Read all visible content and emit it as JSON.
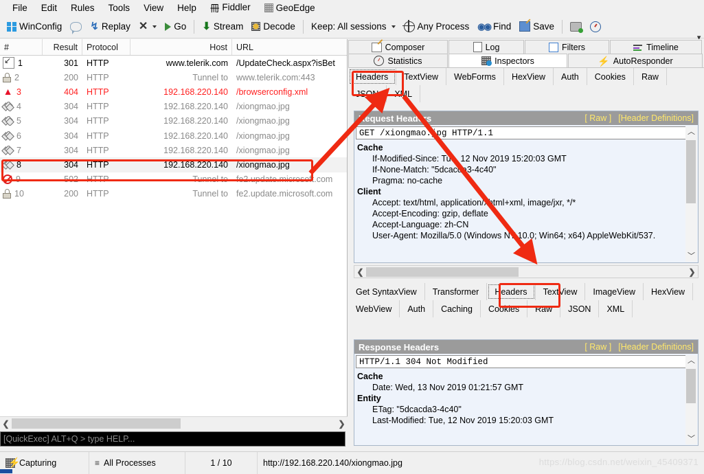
{
  "menu": {
    "items": [
      {
        "label": "File",
        "icon": ""
      },
      {
        "label": "Edit",
        "icon": ""
      },
      {
        "label": "Rules",
        "icon": ""
      },
      {
        "label": "Tools",
        "icon": ""
      },
      {
        "label": "View",
        "icon": ""
      },
      {
        "label": "Help",
        "icon": ""
      },
      {
        "label": "Fiddler",
        "icon": "fiddler-icon"
      },
      {
        "label": "GeoEdge",
        "icon": "geoedge-icon"
      }
    ]
  },
  "toolbar": {
    "winconfig": "WinConfig",
    "comment_icon": "comment-icon",
    "replay": "Replay",
    "clear": "X",
    "go": "Go",
    "stream": "Stream",
    "decode": "Decode",
    "keep_sessions": "Keep: All sessions",
    "any_process": "Any Process",
    "find": "Find",
    "save": "Save",
    "screenshot_icon": "camera-icon",
    "timer_icon": "stopwatch-icon"
  },
  "sessions": {
    "columns": [
      "#",
      "Result",
      "Protocol",
      "Host",
      "URL"
    ],
    "rows": [
      {
        "icon": "redirect-icon",
        "num": "1",
        "result": "301",
        "protocol": "HTTP",
        "host": "www.telerik.com",
        "url": "/UpdateCheck.aspx?isBet",
        "style": "dark"
      },
      {
        "icon": "lock-icon",
        "num": "2",
        "result": "200",
        "protocol": "HTTP",
        "host": "Tunnel to",
        "url": "www.telerik.com:443",
        "style": "grey"
      },
      {
        "icon": "warning-icon",
        "num": "3",
        "result": "404",
        "protocol": "HTTP",
        "host": "192.168.220.140",
        "url": "/browserconfig.xml",
        "style": "err"
      },
      {
        "icon": "cache-icon",
        "num": "4",
        "result": "304",
        "protocol": "HTTP",
        "host": "192.168.220.140",
        "url": "/xiongmao.jpg",
        "style": "grey"
      },
      {
        "icon": "cache-icon",
        "num": "5",
        "result": "304",
        "protocol": "HTTP",
        "host": "192.168.220.140",
        "url": "/xiongmao.jpg",
        "style": "grey"
      },
      {
        "icon": "cache-icon",
        "num": "6",
        "result": "304",
        "protocol": "HTTP",
        "host": "192.168.220.140",
        "url": "/xiongmao.jpg",
        "style": "grey"
      },
      {
        "icon": "cache-icon",
        "num": "7",
        "result": "304",
        "protocol": "HTTP",
        "host": "192.168.220.140",
        "url": "/xiongmao.jpg",
        "style": "grey"
      },
      {
        "icon": "cache-icon",
        "num": "8",
        "result": "304",
        "protocol": "HTTP",
        "host": "192.168.220.140",
        "url": "/xiongmao.jpg",
        "style": "sel"
      },
      {
        "icon": "blocked-icon",
        "num": "9",
        "result": "502",
        "protocol": "HTTP",
        "host": "Tunnel to",
        "url": "fe2.update.microsoft.com",
        "style": "grey"
      },
      {
        "icon": "lock-icon",
        "num": "10",
        "result": "200",
        "protocol": "HTTP",
        "host": "Tunnel to",
        "url": "fe2.update.microsoft.com",
        "style": "grey"
      }
    ]
  },
  "quickexec": {
    "placeholder": "[QuickExec] ALT+Q > type HELP..."
  },
  "inspector": {
    "top_tabs_row1": [
      {
        "label": "Composer",
        "icon": "composer-icon",
        "active": false
      },
      {
        "label": "Log",
        "icon": "log-icon",
        "active": false
      },
      {
        "label": "Filters",
        "icon": "filters-icon",
        "active": false
      },
      {
        "label": "Timeline",
        "icon": "timeline-icon",
        "active": false
      }
    ],
    "top_tabs_row2": [
      {
        "label": "Statistics",
        "icon": "statistics-icon",
        "active": false
      },
      {
        "label": "Inspectors",
        "icon": "inspectors-icon",
        "active": true
      },
      {
        "label": "AutoResponder",
        "icon": "autoresponder-icon",
        "active": false
      }
    ],
    "request_tabs": [
      "Headers",
      "TextView",
      "WebForms",
      "HexView",
      "Auth",
      "Cookies",
      "Raw",
      "JSON",
      "XML"
    ],
    "request_selected": "Headers",
    "response_tabs": [
      "Get SyntaxView",
      "Transformer",
      "Headers",
      "TextView",
      "ImageView",
      "HexView",
      "WebView",
      "Auth",
      "Caching",
      "Cookies",
      "Raw",
      "JSON",
      "XML"
    ],
    "response_selected": "Headers"
  },
  "request_headers": {
    "title": "Request Headers",
    "link_raw": "[ Raw ]",
    "link_defs": "[Header Definitions]",
    "request_line": "GET /xiongmao.jpg HTTP/1.1",
    "groups": [
      {
        "name": "Cache",
        "lines": [
          "If-Modified-Since: Tue, 12 Nov 2019 15:20:03 GMT",
          "If-None-Match: \"5dcacda3-4c40\"",
          "Pragma: no-cache"
        ]
      },
      {
        "name": "Client",
        "lines": [
          "Accept: text/html, application/xhtml+xml, image/jxr, */*",
          "Accept-Encoding: gzip, deflate",
          "Accept-Language: zh-CN",
          "User-Agent: Mozilla/5.0 (Windows NT 10.0; Win64; x64) AppleWebKit/537."
        ]
      }
    ]
  },
  "response_headers": {
    "title": "Response Headers",
    "link_raw": "[ Raw ]",
    "link_defs": "[Header Definitions]",
    "status_line": "HTTP/1.1 304 Not Modified",
    "groups": [
      {
        "name": "Cache",
        "lines": [
          "Date: Wed, 13 Nov 2019 01:21:57 GMT"
        ]
      },
      {
        "name": "Entity",
        "lines": [
          "ETag: \"5dcacda3-4c40\"",
          "Last-Modified: Tue, 12 Nov 2019 15:20:03 GMT"
        ]
      }
    ]
  },
  "statusbar": {
    "capturing": "Capturing",
    "processes": "All Processes",
    "count": "1 / 10",
    "url": "http://192.168.220.140/xiongmao.jpg",
    "watermark": "https://blog.csdn.net/weixin_45409371"
  },
  "colors": {
    "annotation": "#ef2a12",
    "error_text": "#ff1f1f",
    "header_bar": "#9b9b9b",
    "header_link": "#ffe86b",
    "panel_bg": "#eef3fb"
  }
}
